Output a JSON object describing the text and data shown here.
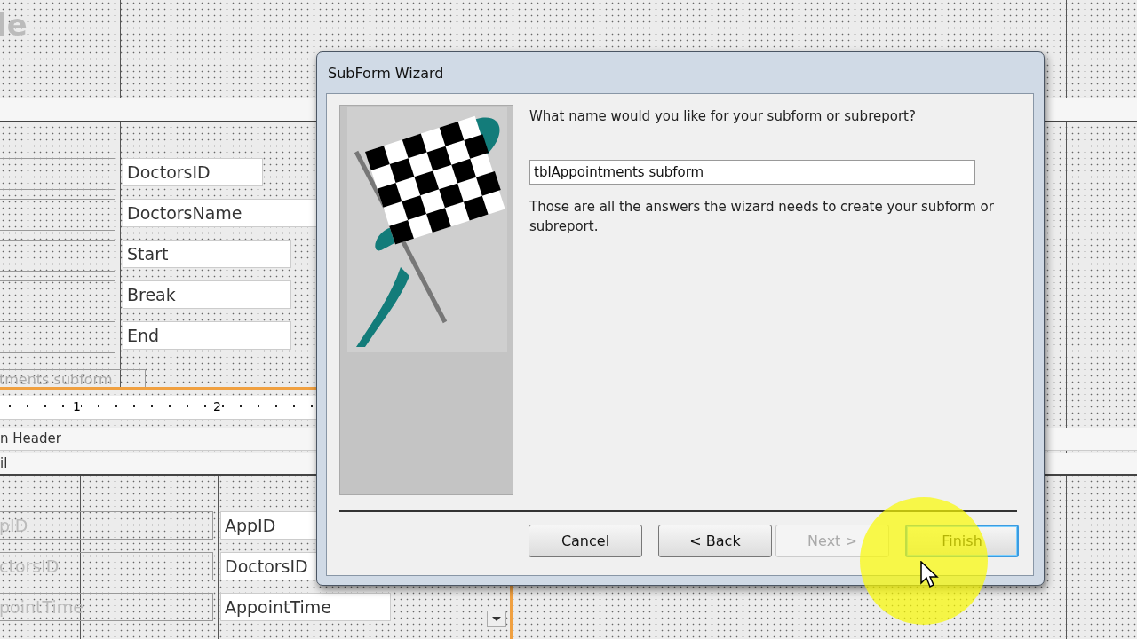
{
  "design_form": {
    "title_fragment": "le",
    "upper_fields": [
      {
        "label": "DoctorsID"
      },
      {
        "label": "DoctorsName"
      },
      {
        "label": "Start"
      },
      {
        "label": "Break"
      },
      {
        "label": "End"
      }
    ],
    "subform_label": "tments subform",
    "ruler_numbers": [
      "1",
      "2"
    ],
    "section_bars": [
      "n Header",
      "il"
    ],
    "lower_fields": [
      {
        "caption": "pID",
        "label": "AppID"
      },
      {
        "caption": "ctorsID",
        "label": "DoctorsID"
      },
      {
        "caption": "pointTime",
        "label": "AppointTime"
      }
    ]
  },
  "dialog": {
    "title": "SubForm Wizard",
    "question": "What name would you like for your subform or subreport?",
    "name_field": {
      "value": "tblAppointments subform"
    },
    "info": "Those are all the answers the wizard needs to create your subform or subreport.",
    "buttons": [
      {
        "label": "Cancel",
        "disabled": false,
        "focused": false
      },
      {
        "label": "< Back",
        "disabled": false,
        "focused": false
      },
      {
        "label": "Next >",
        "disabled": true,
        "focused": false
      },
      {
        "label": "Finish",
        "disabled": false,
        "focused": true
      }
    ]
  }
}
